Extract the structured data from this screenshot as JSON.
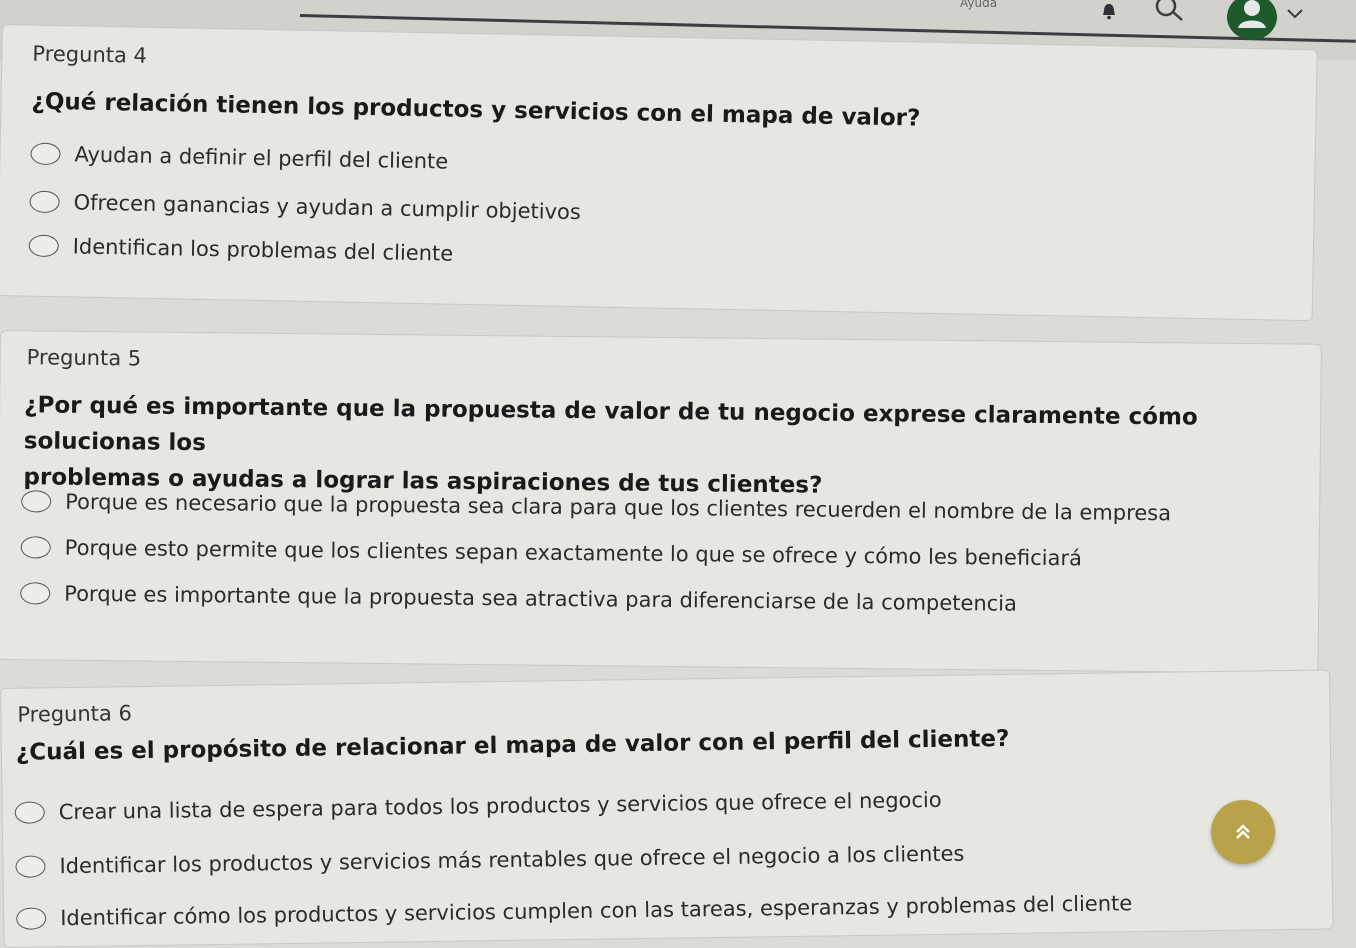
{
  "header": {
    "partial_text": "Ayuda",
    "icons": [
      "bell-icon",
      "search-icon",
      "user-icon",
      "chevron-down-icon"
    ]
  },
  "questions": [
    {
      "label": "Pregunta 4",
      "text": "¿Qué relación tienen los productos y servicios con el mapa de valor?",
      "options": [
        "Ayudan a definir el perfil del cliente",
        "Ofrecen ganancias y ayudan a cumplir objetivos",
        "Identifican los problemas del cliente"
      ]
    },
    {
      "label": "Pregunta 5",
      "text_line1": "¿Por qué es importante que la propuesta de valor de tu negocio exprese claramente cómo solucionas los",
      "text_line2": "problemas o ayudas a lograr las aspiraciones de tus clientes?",
      "options": [
        "Porque es necesario que la propuesta sea clara para que los clientes recuerden el nombre de la empresa",
        "Porque esto permite que los clientes sepan exactamente lo que se ofrece y cómo les beneficiará",
        "Porque es importante que la propuesta sea atractiva para diferenciarse de la competencia"
      ]
    },
    {
      "label": "Pregunta 6",
      "text": "¿Cuál es el propósito de relacionar el mapa de valor con el perfil del cliente?",
      "options": [
        "Crear una lista de espera para todos los productos y servicios que ofrece el negocio",
        "Identificar los productos y servicios más rentables que ofrece el negocio a los clientes",
        "Identificar cómo los productos y servicios cumplen con las tareas, esperanzas y problemas del cliente"
      ]
    }
  ],
  "colors": {
    "scroll_button": "#b9a34a",
    "avatar": "#1f5a2f"
  }
}
